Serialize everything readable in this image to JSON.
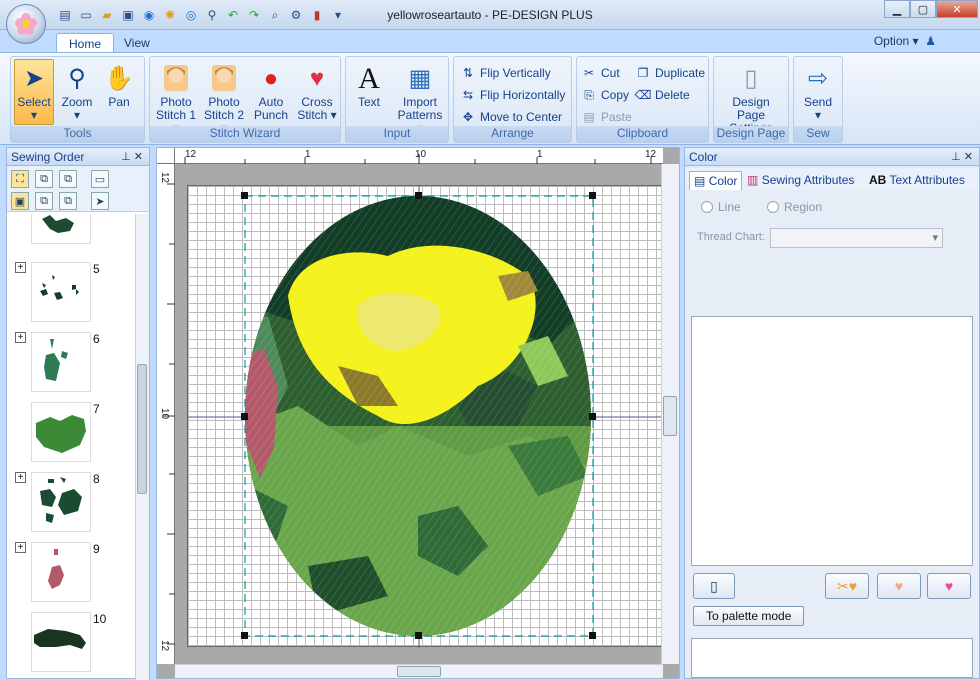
{
  "window": {
    "title": "yellowroseartauto - PE-DESIGN PLUS"
  },
  "quick_access": [
    "new-icon",
    "open-icon",
    "save-icon",
    "circle-tool-icon",
    "star-tool-icon",
    "ring-tool-icon",
    "zoom-icon",
    "undo-icon",
    "redo-icon",
    "preview-icon",
    "settings-icon",
    "color-icon"
  ],
  "tabs": [
    {
      "label": "Home",
      "active": true
    },
    {
      "label": "View",
      "active": false
    }
  ],
  "option_label": "Option",
  "ribbon": {
    "tools": {
      "label": "Tools",
      "buttons": [
        "Select",
        "Zoom",
        "Pan"
      ]
    },
    "stitch_wizard": {
      "label": "Stitch Wizard",
      "buttons": [
        {
          "l1": "Photo",
          "l2": "Stitch 1 ▾"
        },
        {
          "l1": "Photo",
          "l2": "Stitch 2 ▾"
        },
        {
          "l1": "Auto",
          "l2": "Punch"
        },
        {
          "l1": "Cross",
          "l2": "Stitch ▾"
        }
      ]
    },
    "input": {
      "label": "Input",
      "buttons": [
        {
          "l1": "Text",
          "l2": ""
        },
        {
          "l1": "Import",
          "l2": "Patterns ▾"
        }
      ]
    },
    "arrange": {
      "label": "Arrange",
      "buttons": [
        "Flip Vertically",
        "Flip Horizontally",
        "Move to Center"
      ]
    },
    "clipboard": {
      "label": "Clipboard",
      "buttons": [
        "Cut",
        "Copy",
        "Paste",
        "Duplicate",
        "Delete"
      ]
    },
    "design_page": {
      "label": "Design Page",
      "l1": "Design Page",
      "l2": "Settings"
    },
    "sew": {
      "label": "Sew",
      "l1": "Send",
      "l2": "▾"
    }
  },
  "sewing_order": {
    "title": "Sewing Order",
    "items": [
      {
        "num": "",
        "color": "#1d4a30"
      },
      {
        "num": "5",
        "color": "#163d28"
      },
      {
        "num": "6",
        "color": "#2e7a52"
      },
      {
        "num": "7",
        "color": "#3a8a36"
      },
      {
        "num": "8",
        "color": "#1b4b30"
      },
      {
        "num": "9",
        "color": "#b35a6a"
      },
      {
        "num": "10",
        "color": "#1a3322"
      }
    ]
  },
  "ruler": {
    "h_labels": [
      "12",
      "1",
      "10",
      "1",
      "12"
    ],
    "v_labels": [
      "12",
      "10",
      "12"
    ]
  },
  "color_panel": {
    "title": "Color",
    "tabs": [
      "Color",
      "Sewing Attributes",
      "Text Attributes"
    ],
    "line_label": "Line",
    "region_label": "Region",
    "thread_chart_label": "Thread Chart:",
    "palette_button": "To palette mode"
  },
  "colors": {
    "accent": "#15428b",
    "select_highlight": "#fbb94a"
  }
}
